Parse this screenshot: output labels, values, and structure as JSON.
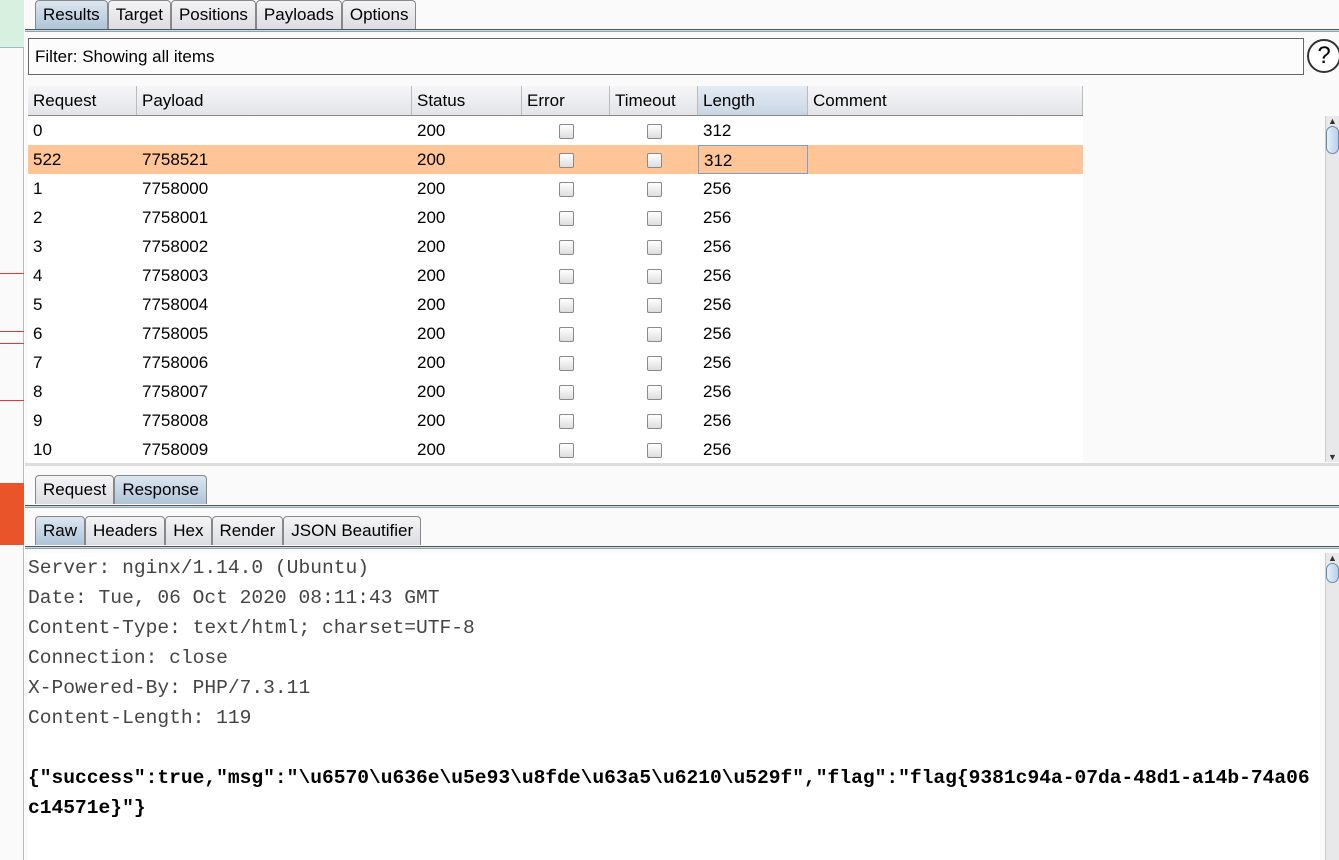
{
  "top_tabs": [
    {
      "label": "Results",
      "active": true
    },
    {
      "label": "Target"
    },
    {
      "label": "Positions"
    },
    {
      "label": "Payloads"
    },
    {
      "label": "Options"
    }
  ],
  "filter": {
    "text": "Filter: Showing all items",
    "help_icon": "?"
  },
  "table": {
    "columns": [
      "Request",
      "Payload",
      "Status",
      "Error",
      "Timeout",
      "Length",
      "Comment"
    ],
    "sorted_column": "Length",
    "rows": [
      {
        "request": "0",
        "payload": "",
        "status": "200",
        "error": false,
        "timeout": false,
        "length": "312",
        "comment": ""
      },
      {
        "request": "522",
        "payload": "7758521",
        "status": "200",
        "error": false,
        "timeout": false,
        "length": "312",
        "comment": "",
        "highlighted": true
      },
      {
        "request": "1",
        "payload": "7758000",
        "status": "200",
        "error": false,
        "timeout": false,
        "length": "256",
        "comment": ""
      },
      {
        "request": "2",
        "payload": "7758001",
        "status": "200",
        "error": false,
        "timeout": false,
        "length": "256",
        "comment": ""
      },
      {
        "request": "3",
        "payload": "7758002",
        "status": "200",
        "error": false,
        "timeout": false,
        "length": "256",
        "comment": ""
      },
      {
        "request": "4",
        "payload": "7758003",
        "status": "200",
        "error": false,
        "timeout": false,
        "length": "256",
        "comment": ""
      },
      {
        "request": "5",
        "payload": "7758004",
        "status": "200",
        "error": false,
        "timeout": false,
        "length": "256",
        "comment": ""
      },
      {
        "request": "6",
        "payload": "7758005",
        "status": "200",
        "error": false,
        "timeout": false,
        "length": "256",
        "comment": ""
      },
      {
        "request": "7",
        "payload": "7758006",
        "status": "200",
        "error": false,
        "timeout": false,
        "length": "256",
        "comment": ""
      },
      {
        "request": "8",
        "payload": "7758007",
        "status": "200",
        "error": false,
        "timeout": false,
        "length": "256",
        "comment": ""
      },
      {
        "request": "9",
        "payload": "7758008",
        "status": "200",
        "error": false,
        "timeout": false,
        "length": "256",
        "comment": ""
      },
      {
        "request": "10",
        "payload": "7758009",
        "status": "200",
        "error": false,
        "timeout": false,
        "length": "256",
        "comment": ""
      }
    ]
  },
  "rr_tabs": [
    {
      "label": "Request"
    },
    {
      "label": "Response",
      "active": true
    }
  ],
  "view_tabs": [
    {
      "label": "Raw",
      "active": true
    },
    {
      "label": "Headers"
    },
    {
      "label": "Hex"
    },
    {
      "label": "Render"
    },
    {
      "label": "JSON Beautifier"
    }
  ],
  "response": {
    "headers": [
      "Server: nginx/1.14.0 (Ubuntu)",
      "Date: Tue, 06 Oct 2020 08:11:43 GMT",
      "Content-Type: text/html; charset=UTF-8",
      "Connection: close",
      "X-Powered-By: PHP/7.3.11",
      "Content-Length: 119"
    ],
    "body": "{\"success\":true,\"msg\":\"\\u6570\\u636e\\u5e93\\u8fde\\u63a5\\u6210\\u529f\",\"flag\":\"flag{9381c94a-07da-48d1-a14b-74a06c14571e}\"}"
  },
  "colors": {
    "highlight_row": "#ffc597",
    "active_tab": "#aec4d8"
  }
}
